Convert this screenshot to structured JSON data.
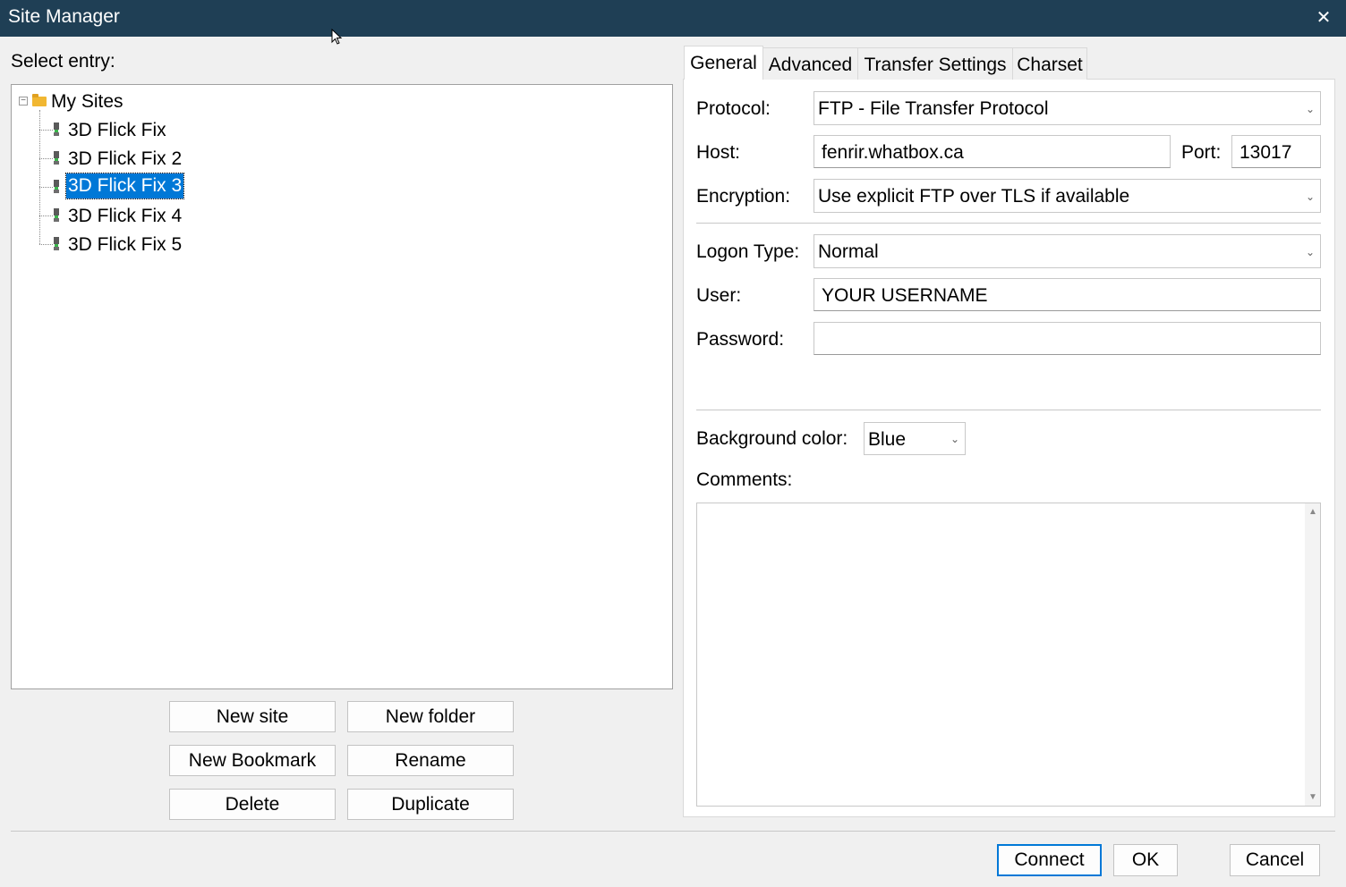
{
  "window": {
    "title": "Site Manager",
    "close_glyph": "✕"
  },
  "select_entry_label": "Select entry:",
  "tree": {
    "root": {
      "label": "My Sites",
      "icon": "folder-icon",
      "expander": "−"
    },
    "items": [
      {
        "label": "3D Flick Fix",
        "selected": false
      },
      {
        "label": "3D Flick Fix 2",
        "selected": false
      },
      {
        "label": "3D Flick Fix 3",
        "selected": true
      },
      {
        "label": "3D Flick Fix 4",
        "selected": false
      },
      {
        "label": "3D Flick Fix 5",
        "selected": false
      }
    ]
  },
  "left_buttons": {
    "new_site": "New site",
    "new_folder": "New folder",
    "new_bookmark": "New Bookmark",
    "rename": "Rename",
    "delete": "Delete",
    "duplicate": "Duplicate"
  },
  "tabs": [
    {
      "label": "General",
      "active": true
    },
    {
      "label": "Advanced",
      "active": false
    },
    {
      "label": "Transfer Settings",
      "active": false
    },
    {
      "label": "Charset",
      "active": false
    }
  ],
  "general": {
    "protocol_label": "Protocol:",
    "protocol_value": "FTP - File Transfer Protocol",
    "host_label": "Host:",
    "host_value": "fenrir.whatbox.ca",
    "port_label": "Port:",
    "port_value": "13017",
    "encryption_label": "Encryption:",
    "encryption_value": "Use explicit FTP over TLS if available",
    "logon_type_label": "Logon Type:",
    "logon_type_value": "Normal",
    "user_label": "User:",
    "user_value": "YOUR USERNAME",
    "password_label": "Password:",
    "password_value": "",
    "bg_color_label": "Background color:",
    "bg_color_value": "Blue",
    "comments_label": "Comments:",
    "comments_value": ""
  },
  "footer_buttons": {
    "connect": "Connect",
    "ok": "OK",
    "cancel": "Cancel"
  },
  "colors": {
    "titlebar": "#1f3f55",
    "selection": "#0078d7",
    "default_button_border": "#0078d7"
  },
  "glyphs": {
    "dropdown": "⌄",
    "scroll_up": "▲",
    "scroll_down": "▼"
  }
}
